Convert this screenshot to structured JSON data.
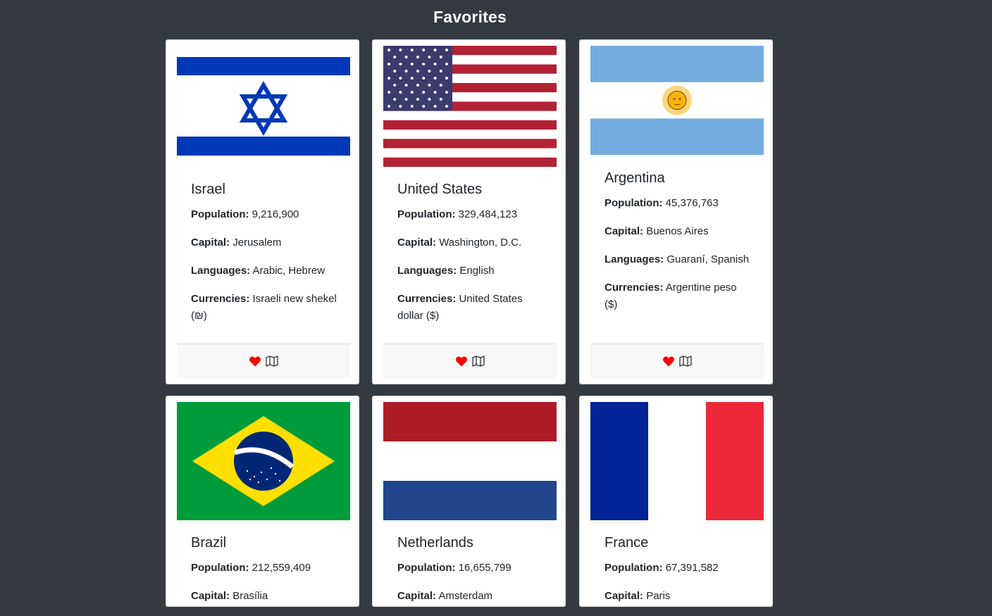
{
  "header": {
    "title": "Favorites"
  },
  "countries": [
    {
      "name": "Israel",
      "population_label": "Population:",
      "population": "9,216,900",
      "capital_label": "Capital:",
      "capital": "Jerusalem",
      "languages_label": "Languages:",
      "languages": "Arabic, Hebrew",
      "currencies_label": "Currencies:",
      "currencies": "Israeli new shekel (₪)"
    },
    {
      "name": "United States",
      "population_label": "Population:",
      "population": "329,484,123",
      "capital_label": "Capital:",
      "capital": "Washington, D.C.",
      "languages_label": "Languages:",
      "languages": "English",
      "currencies_label": "Currencies:",
      "currencies": "United States dollar ($)"
    },
    {
      "name": "Argentina",
      "population_label": "Population:",
      "population": "45,376,763",
      "capital_label": "Capital:",
      "capital": "Buenos Aires",
      "languages_label": "Languages:",
      "languages": "Guaraní, Spanish",
      "currencies_label": "Currencies:",
      "currencies": "Argentine peso ($)"
    },
    {
      "name": "Brazil",
      "population_label": "Population:",
      "population": "212,559,409",
      "capital_label": "Capital:",
      "capital": "Brasília"
    },
    {
      "name": "Netherlands",
      "population_label": "Population:",
      "population": "16,655,799",
      "capital_label": "Capital:",
      "capital": "Amsterdam"
    },
    {
      "name": "France",
      "population_label": "Population:",
      "population": "67,391,582",
      "capital_label": "Capital:",
      "capital": "Paris"
    }
  ],
  "icons": {
    "favorite": "heart-icon",
    "map": "map-icon"
  },
  "colors": {
    "background": "#343a40",
    "heart": "#ff0000"
  }
}
